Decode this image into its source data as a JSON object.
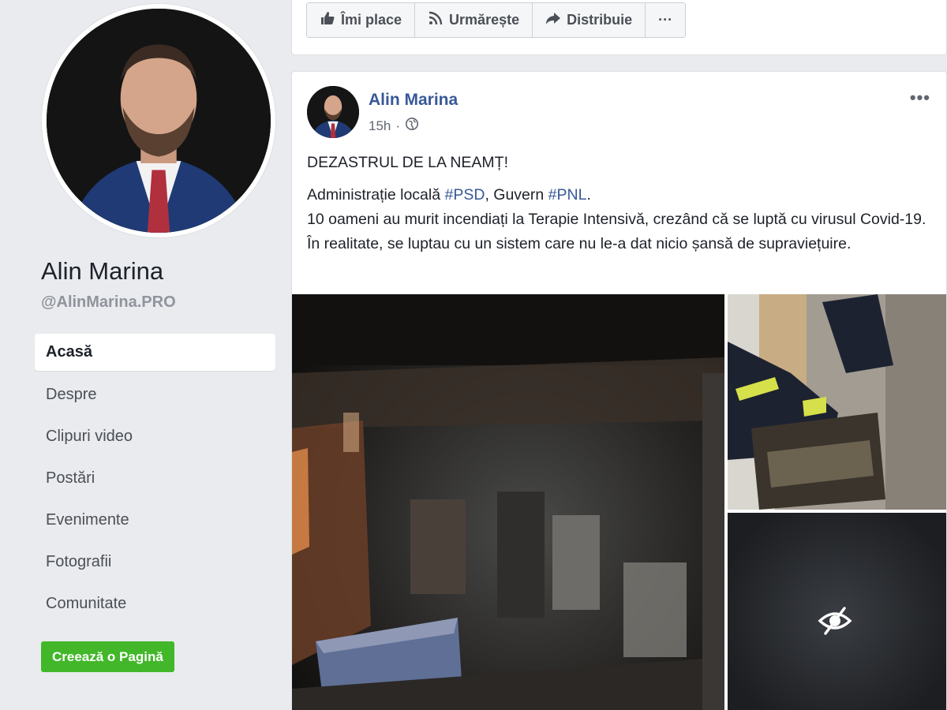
{
  "page": {
    "name": "Alin Marina",
    "handle": "@AlinMarina.PRO"
  },
  "nav": [
    {
      "label": "Acasă",
      "active": true
    },
    {
      "label": "Despre"
    },
    {
      "label": "Clipuri video"
    },
    {
      "label": "Postări"
    },
    {
      "label": "Evenimente"
    },
    {
      "label": "Fotografii"
    },
    {
      "label": "Comunitate"
    }
  ],
  "create_page_label": "Creează o Pagină",
  "actions": {
    "like": "Îmi place",
    "follow": "Urmărește",
    "share": "Distribuie",
    "more": "···"
  },
  "post": {
    "author": "Alin Marina",
    "time": "15h",
    "menu": "•••",
    "headline": "DEZASTRUL DE LA NEAMȚ!",
    "line2_prefix": "Administrație locală ",
    "tag1": "#PSD",
    "line2_mid": ", Guvern ",
    "tag2": "#PNL",
    "line2_suffix": ".",
    "body": "10 oameni au murit incendiați la Terapie Intensivă, crezând că se luptă cu virusul Covid-19. În realitate, se luptau cu un sistem care nu le-a dat nicio șansă de supraviețuire."
  },
  "colors": {
    "link": "#385898",
    "create_button": "#42b72a",
    "background": "#e9ebee"
  }
}
